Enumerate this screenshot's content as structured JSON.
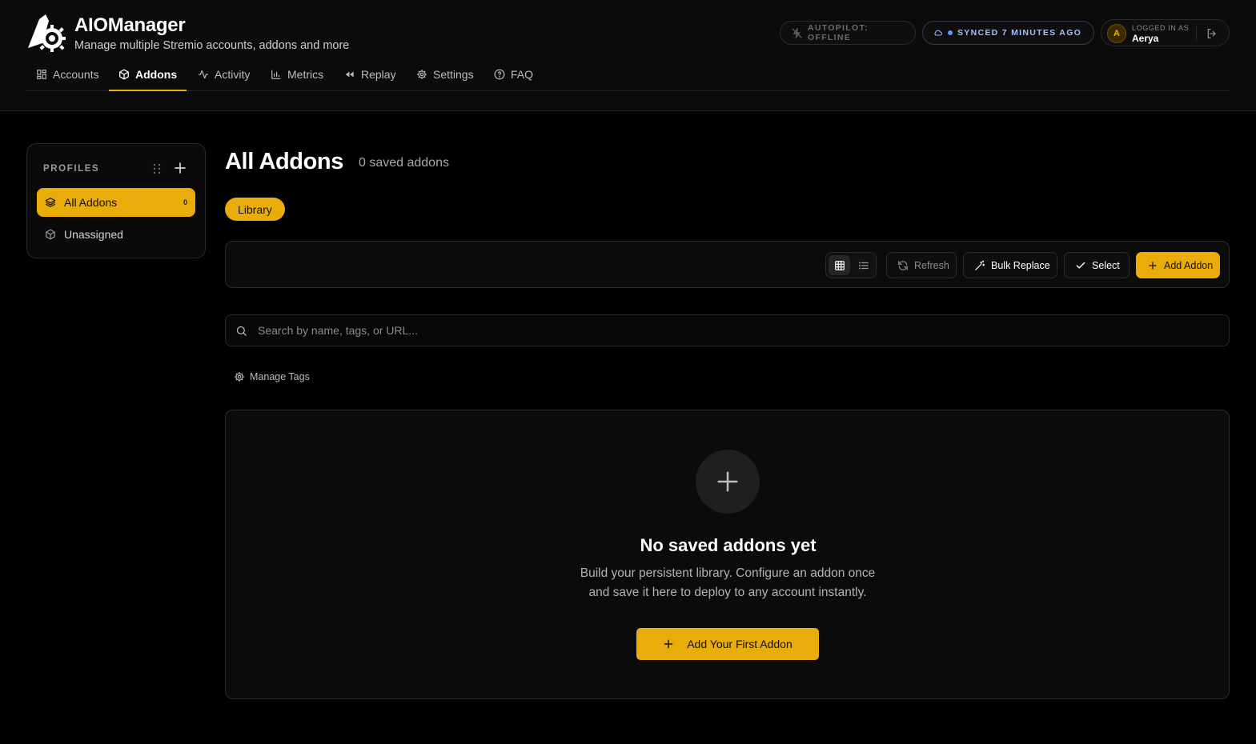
{
  "app": {
    "title": "AIOManager",
    "subtitle": "Manage multiple Stremio accounts, addons and more"
  },
  "status": {
    "autopilot": "AUTOPILOT: OFFLINE",
    "synced": "SYNCED 7 MINUTES AGO"
  },
  "user": {
    "label": "LOGGED IN AS",
    "name": "Aerya",
    "initial": "A"
  },
  "nav": {
    "tabs": [
      {
        "label": "Accounts",
        "icon": "grid-icon"
      },
      {
        "label": "Addons",
        "icon": "package-icon",
        "active": true
      },
      {
        "label": "Activity",
        "icon": "activity-icon"
      },
      {
        "label": "Metrics",
        "icon": "bar-chart-icon"
      },
      {
        "label": "Replay",
        "icon": "rewind-icon"
      },
      {
        "label": "Settings",
        "icon": "gear-icon"
      },
      {
        "label": "FAQ",
        "icon": "help-circle-icon"
      }
    ]
  },
  "sidebar": {
    "title": "PROFILES",
    "items": [
      {
        "label": "All Addons",
        "count": "0",
        "icon": "layers-icon",
        "active": true
      },
      {
        "label": "Unassigned",
        "icon": "package-icon"
      }
    ]
  },
  "main": {
    "title": "All Addons",
    "count_text": "0 saved addons",
    "chip": "Library",
    "toolbar": {
      "refresh": "Refresh",
      "bulk_replace": "Bulk Replace",
      "select": "Select",
      "add_addon": "Add Addon"
    },
    "search": {
      "placeholder": "Search by name, tags, or URL..."
    },
    "manage_tags": "Manage Tags",
    "empty": {
      "title": "No saved addons yet",
      "line1": "Build your persistent library. Configure an addon once",
      "line2": "and save it here to deploy to any account instantly.",
      "button": "Add Your First Addon"
    }
  },
  "colors": {
    "accent": "#e8ad0b",
    "background": "#000000",
    "sync": "#9ec3ff"
  }
}
